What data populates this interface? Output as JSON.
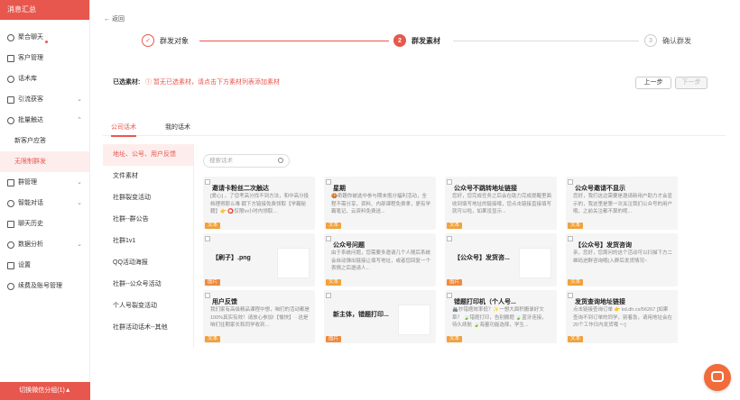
{
  "sidebar": {
    "title": "消息汇总",
    "items": [
      {
        "label": "聚合聊天",
        "icon": "chat-icon",
        "dot": true
      },
      {
        "label": "客户管理",
        "icon": "user-icon"
      },
      {
        "label": "话术库",
        "icon": "book-icon"
      },
      {
        "label": "引流获客",
        "icon": "funnel-icon",
        "chevron": "⌄"
      },
      {
        "label": "批量触达",
        "icon": "send-icon",
        "chevron": "⌃"
      },
      {
        "label": "新客户应答",
        "sub": true
      },
      {
        "label": "无限制群发",
        "sub": true,
        "active": true
      },
      {
        "label": "群管理",
        "icon": "group-icon",
        "chevron": "⌄"
      },
      {
        "label": "智能对话",
        "icon": "robot-icon",
        "chevron": "⌄"
      },
      {
        "label": "聊天历史",
        "icon": "history-icon"
      },
      {
        "label": "数据分析",
        "icon": "chart-icon",
        "chevron": "⌄"
      },
      {
        "label": "设置",
        "icon": "gear-icon"
      },
      {
        "label": "续费及账号管理",
        "icon": "plus-icon"
      }
    ],
    "footer": "切换微信分组(1)▲"
  },
  "main": {
    "back": "返回",
    "steps": [
      {
        "num": "✓",
        "label": "群发对象",
        "state": "done"
      },
      {
        "num": "2",
        "label": "群发素材",
        "state": "current"
      },
      {
        "num": "3",
        "label": "确认群发",
        "state": "todo"
      }
    ],
    "selected_label": "已选素材:",
    "selected_tip": "ⓘ 暂无已选素材，请点击下方素材列表添加素材",
    "prev": "上一步",
    "next": "下一步",
    "tabs": [
      "公司话术",
      "我的话术"
    ],
    "categories": [
      "地址、公号、用户反馈",
      "文件素材",
      "社群裂变活动",
      "社群--群公告",
      "社群1v1",
      "QQ活动海报",
      "社群--公众号活动",
      "个人号裂变活动",
      "社群活动话术--其他"
    ],
    "search_placeholder": "搜索话术",
    "cards": [
      {
        "title": "邀请卡粉丝二次触达",
        "body": "[爱心] ，了您考高分找不到方法，和中高分投档理得那么难 戳下方链接免费领取【学霸秘籍】👉 ⭕仅限\\n小时内领取...",
        "tag": "文本"
      },
      {
        "title": "星期",
        "body": "🍪奇趣你被选中参与期末抱分福利活动，全程不需分享，资料、内部课程免费拿，更有学霸笔记、云资料免费送...",
        "tag": "文本"
      },
      {
        "title": "公众号不跳转地址链接",
        "body": "您好，您完成任务之后会在助力完成提醒里面收到填写地址的链接哦，您点击链接直接填写就可以啦，如果没显示...",
        "tag": "文本"
      },
      {
        "title": "公众号邀请不显示",
        "body": "您好，我们这边需要是邀请新用户助力才会显示的，我这里是第一次关注我们公众号的用户哦，之前关注都不算的呢...",
        "tag": "文本"
      },
      {
        "title": "【刷子】.png",
        "body": "",
        "tag": "图片",
        "thumb": true
      },
      {
        "title": "公众号问题",
        "body": "由于系统问题，您需要多邀请几个人随后系统会自动弹出链接让填写地址，或者您回复一个表情之后邀请人...",
        "tag": "文本"
      },
      {
        "title": "【公众号】发货咨...",
        "body": "",
        "tag": "图片",
        "thumb": true
      },
      {
        "title": "【公众号】发货咨询",
        "body": "亲，您好，您周问的这个活动可以扫描下方二维码进群咨询哦(入群后发货情况~",
        "tag": "文本"
      },
      {
        "title": "用户反馈",
        "body": "我们家有高级精品课程中想，咱们的活动都是100%真实有效！请放心参加!【愉快】 · 这是咱们往期家长和同学收到...",
        "tag": "文本"
      },
      {
        "title": "新主体，错题打印...",
        "body": "",
        "tag": "图片",
        "thumb": true
      },
      {
        "title": "错题打印机（个人号...",
        "body": "🖨️抄错题效率低？✨一想大面积搬录好文章？ 🍃错题打印，告别搬题 🍃蓝牙连接，待久续航 🍃海量功能选择，学生...",
        "tag": "文本"
      },
      {
        "title": "发货查询地址链接",
        "body": "点击链接查询订单 👉 kd.dh.cx/56267 [如果查询不到订单的同学，别着急，请用地址会在20个工作日内发货哦 ～]",
        "tag": "文本"
      }
    ]
  }
}
